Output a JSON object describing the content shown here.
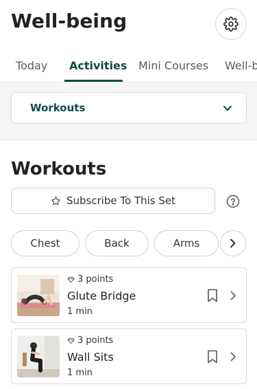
{
  "header": {
    "title": "Well-being",
    "settings_icon": "gear-icon"
  },
  "tabs": [
    {
      "label": "Today",
      "active": false
    },
    {
      "label": "Activities",
      "active": true
    },
    {
      "label": "Mini Courses",
      "active": false
    },
    {
      "label": "Well-b",
      "active": false
    }
  ],
  "filter": {
    "selected": "Workouts"
  },
  "section": {
    "title": "Workouts",
    "subscribe_label": "Subscribe To This Set"
  },
  "chips": [
    {
      "label": "Chest"
    },
    {
      "label": "Back"
    },
    {
      "label": "Arms"
    }
  ],
  "activities": [
    {
      "points": "3 points",
      "name": "Glute Bridge",
      "duration": "1 min"
    },
    {
      "points": "3 points",
      "name": "Wall Sits",
      "duration": "1 min"
    }
  ],
  "colors": {
    "accent": "#0f4c45",
    "border": "#d9d9d9",
    "background_band": "#f5f5f5"
  }
}
